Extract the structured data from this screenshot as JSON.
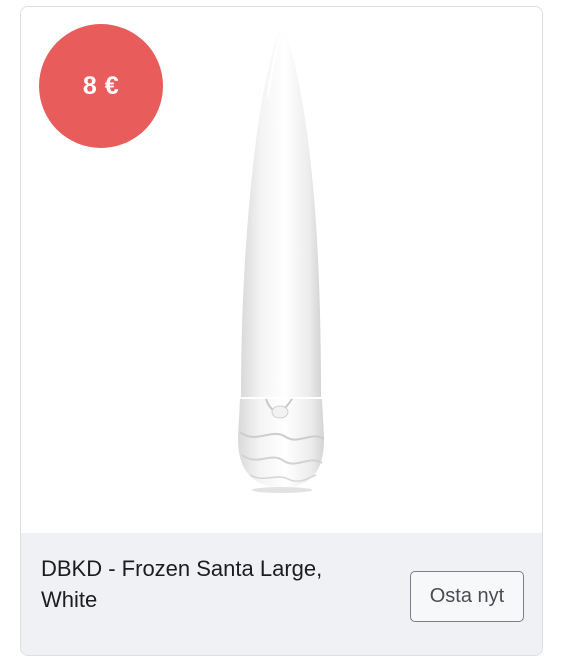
{
  "product": {
    "price": "8 €",
    "title": "DBKD - Frozen Santa Large, White",
    "buy_label": "Osta nyt",
    "accent_color": "#e95c5c"
  }
}
